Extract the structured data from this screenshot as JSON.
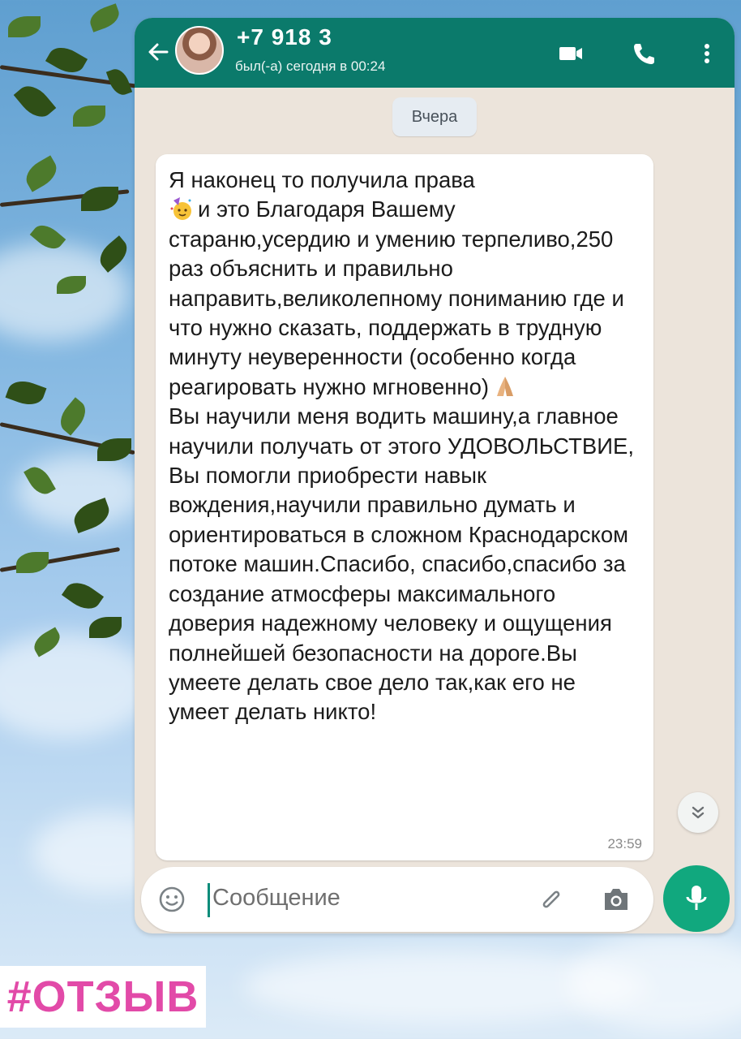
{
  "header": {
    "contact_name": "+7 918 3",
    "status": "был(-а) сегодня в 00:24"
  },
  "date_chip": "Вчера",
  "message": {
    "paragraph_1_line_1": "Я наконец то получила права",
    "paragraph_1_rest": "и это Благодаря Вашему стараню,усердию и умению терпеливо,250 раз объяснить и правильно направить,великолепному пониманию где и что нужно сказать, поддержать в трудную минуту неуверенности (особенно когда реагировать нужно мгновенно)",
    "paragraph_2": "Вы научили меня водить машину,а главное научили получать от этого УДОВОЛЬСТВИЕ, Вы помогли приобрести навык вождения,научили правильно думать и ориентироваться в сложном Краснодарском потоке машин.Спасибо, спасибо,спасибо за создание атмосферы максимального доверия надежному человеку и ощущения полнейшей безопасности на дороге.Вы умеете делать свое дело так,как его не умеет делать никто!",
    "time": "23:59",
    "emojis": [
      "party-face-emoji",
      "folded-hands-emoji"
    ]
  },
  "input": {
    "placeholder": "Сообщение"
  },
  "hashtag": "#ОТЗЫВ",
  "colors": {
    "header": "#0b7a6b",
    "mic_button": "#11a87e",
    "chat_background": "#ece4db",
    "hashtag_text": "#e24aa8"
  }
}
